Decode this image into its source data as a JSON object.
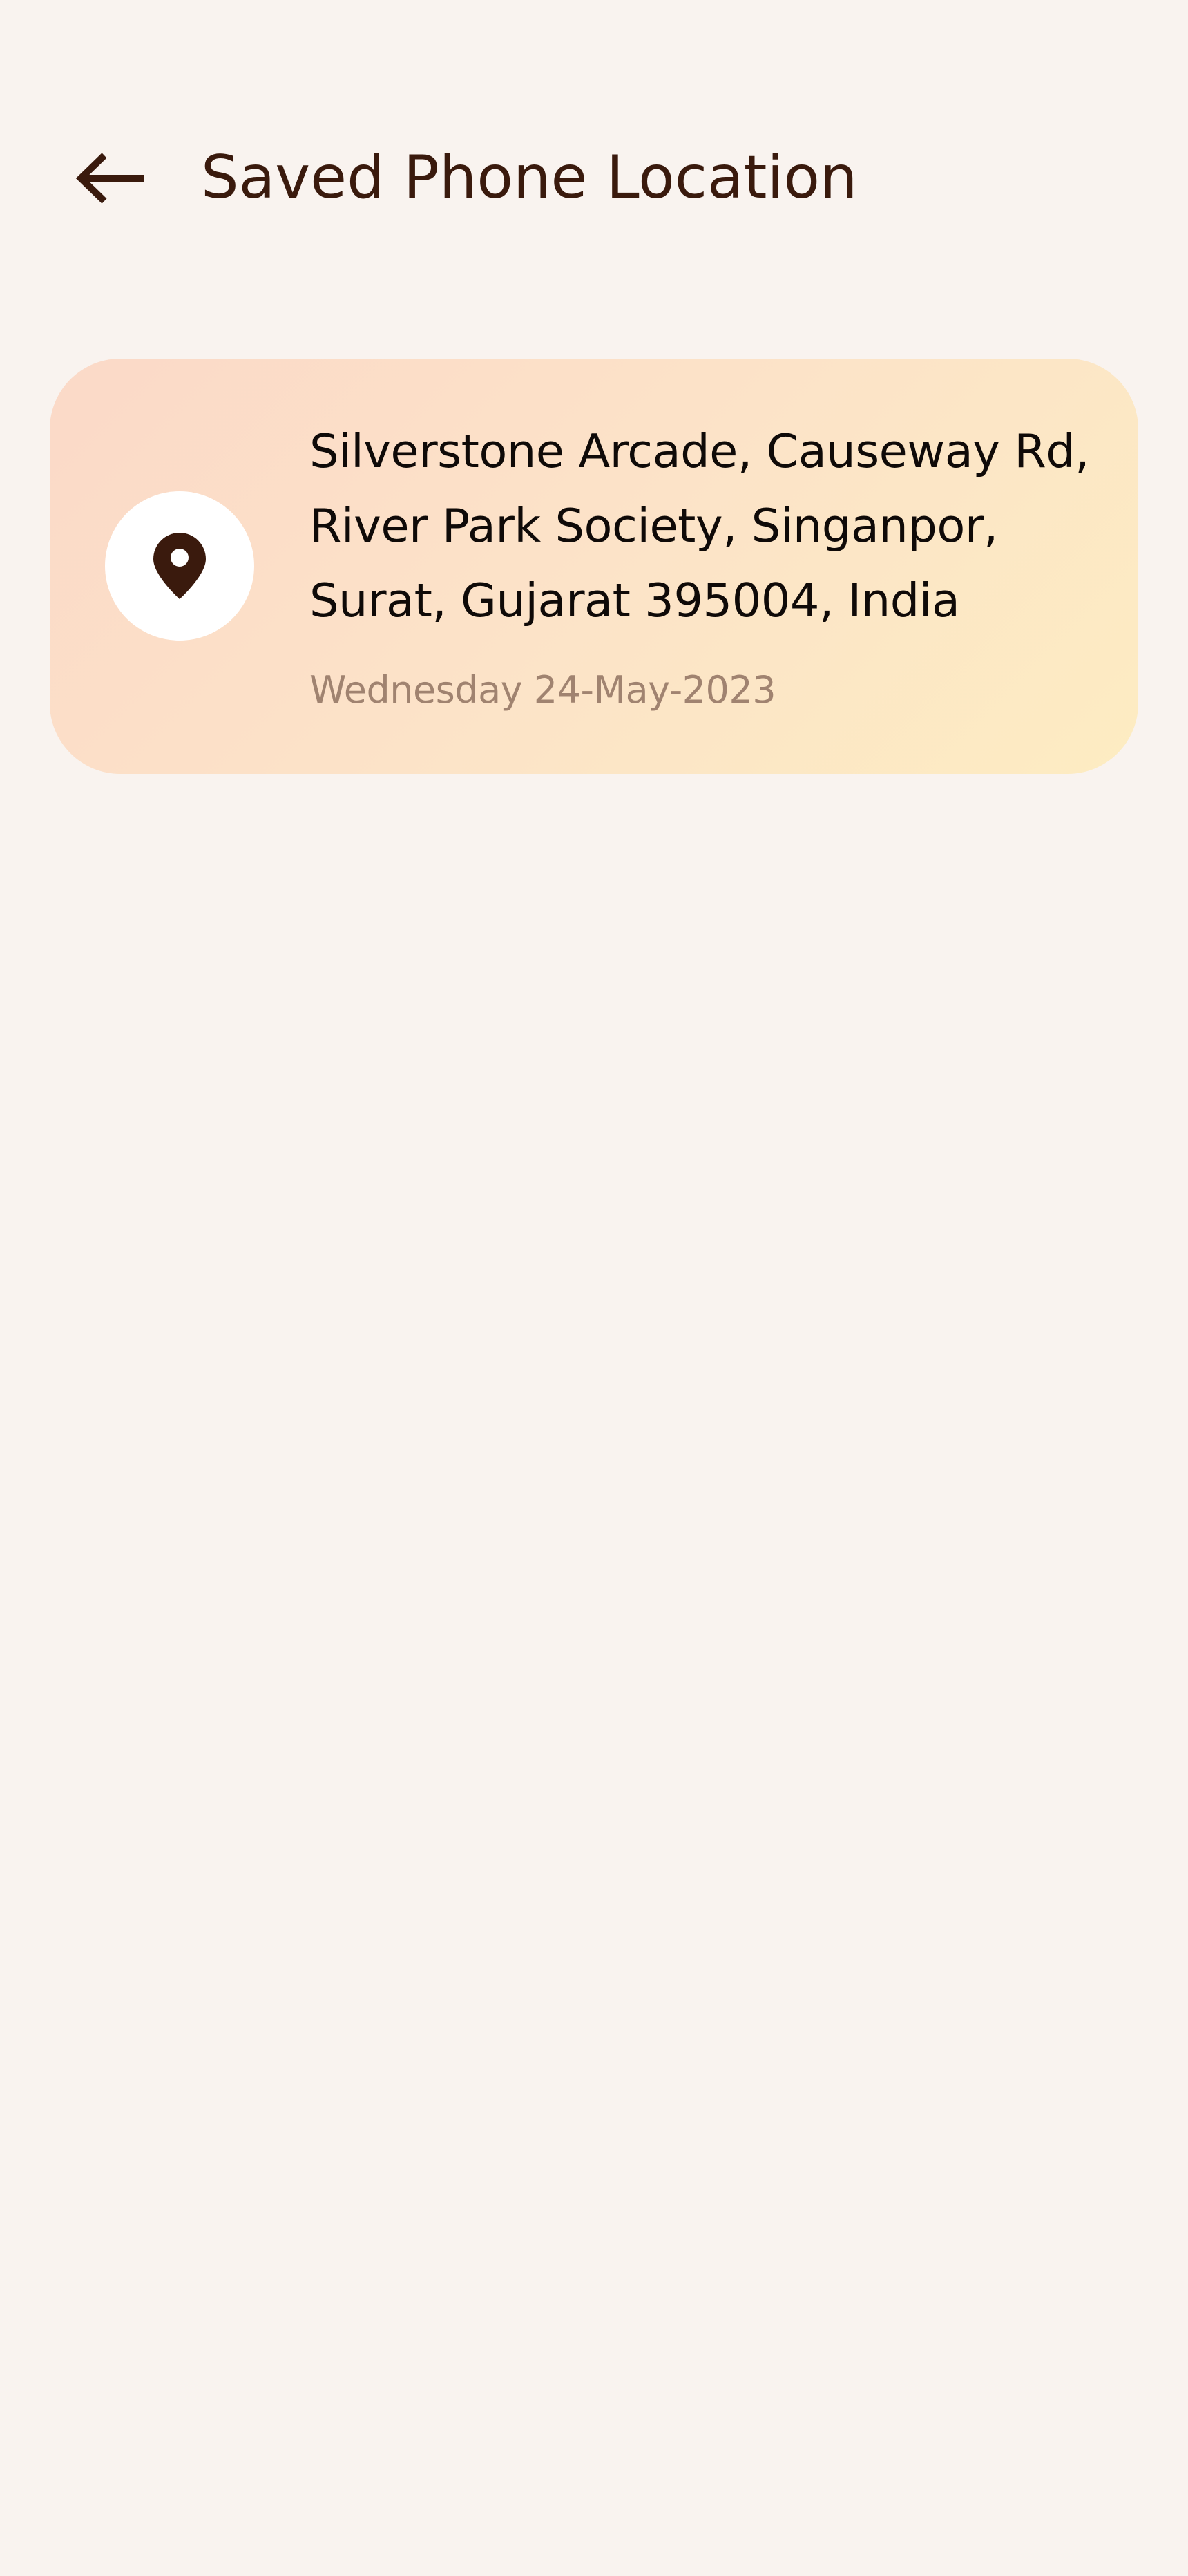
{
  "header": {
    "back_icon": "arrow-left-icon",
    "title": "Saved Phone Location"
  },
  "colors": {
    "background": "#f9f3ef",
    "title": "#3a1a0d",
    "icon": "#3a1a0d",
    "card_gradient_start": "#fbd9c8",
    "card_gradient_end": "#fdecc2",
    "address_text": "#0f0a08",
    "timestamp_text": "#a08370"
  },
  "locations": [
    {
      "icon": "location-pin-icon",
      "address_lines": [
        "Silverstone Arcade, Causeway Rd,",
        "River Park Society, Singanpor,",
        "Surat, Gujarat 395004, India"
      ],
      "timestamp": "Wednesday 24-May-2023"
    }
  ]
}
